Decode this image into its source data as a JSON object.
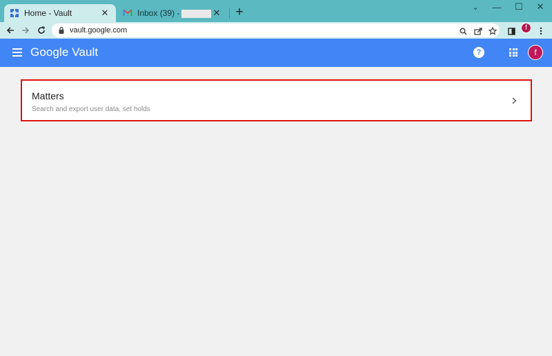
{
  "browser": {
    "tabs": [
      {
        "title": "Home - Vault",
        "active": true
      },
      {
        "title": "Inbox (39) -",
        "active": false
      }
    ],
    "close_glyph": "✕",
    "new_tab_glyph": "+",
    "window_controls": {
      "minimize": "—",
      "maximize": "☐",
      "close": "✕",
      "chevron": "⌄"
    },
    "url": "vault.google.com",
    "profile_initial": "f"
  },
  "app": {
    "title": "Google Vault",
    "help_glyph": "?",
    "avatar_initial": "f",
    "brand_color": "#4285f4"
  },
  "main": {
    "card": {
      "title": "Matters",
      "description": "Search and export user data, set holds",
      "highlight_color": "#e01010"
    }
  }
}
